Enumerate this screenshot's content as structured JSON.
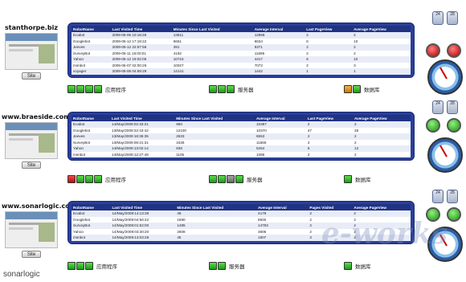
{
  "headers1": [
    "RobotName",
    "Last Visited Time",
    "Minutes Since Last Visited",
    "Average Interval",
    "Last PageView",
    "Average PageView"
  ],
  "headers2": [
    "RobotName",
    "Last Visited Time",
    "Minutes Since Last Visited",
    "Average Interval",
    "Last PageView",
    "Average PageView"
  ],
  "headers3": [
    "RobotName",
    "Last Visited Time",
    "Minutes Since Last Visited",
    "Average Interval",
    "Pages Visited",
    "Average PageView"
  ],
  "site_button": "Site",
  "labels": {
    "app": "应用程序",
    "server": "服务器",
    "db": "数据库"
  },
  "mini": [
    "24",
    "28"
  ],
  "sections": [
    {
      "name": "stanthorpe.biz",
      "rows": [
        [
          "Ecabot",
          "2009-05-06 10:18:26",
          "13511",
          "12966",
          "2",
          "2"
        ],
        [
          "Googlebot",
          "2009-05-12 17:19:22",
          "5651",
          "6634",
          "6",
          "10"
        ],
        [
          "Jeeves",
          "2009-05-12 22:57:56",
          "391",
          "5371",
          "2",
          "2"
        ],
        [
          "SurveyBot",
          "2009-05-11 16:00:01",
          "4192",
          "11695",
          "2",
          "2"
        ],
        [
          "Yahoo",
          "2009-05-12 19:02:05",
          "10715",
          "4417",
          "6",
          "10"
        ],
        [
          "msnbot",
          "2009-05-07 02:00:26",
          "10027",
          "7072",
          "2",
          "3"
        ],
        [
          "voyager",
          "2009-05-06 04:59:29",
          "14141",
          "1442",
          "1",
          "1"
        ]
      ],
      "lights": [
        [
          "g",
          "g",
          "g",
          "g"
        ],
        [
          "g",
          "g",
          "g"
        ],
        [
          "o",
          "g"
        ]
      ]
    },
    {
      "name": "www.braeside.com.au",
      "rows": [
        [
          "Ecabot",
          "14/May/2009:02:33:21",
          "950",
          "10387",
          "2",
          "2"
        ],
        [
          "Googlebot",
          "13/May/2009:22:43:42",
          "12100",
          "10370",
          "47",
          "35"
        ],
        [
          "Jeeves",
          "13/May/2009:18:36:35",
          "2633",
          "6553",
          "2",
          "2"
        ],
        [
          "SurveyBot",
          "13/May/2009:08:21:31",
          "3426",
          "11566",
          "2",
          "2"
        ],
        [
          "Yahoo",
          "14/May/2009:13:02:14",
          "836",
          "5264",
          "5",
          "12"
        ],
        [
          "msnbot",
          "14/May/2009:12:27:48",
          "1105",
          "1086",
          "2",
          "2"
        ]
      ],
      "lights": [
        [
          "r",
          "g",
          "g",
          "g"
        ],
        [
          "g",
          "g",
          "gr",
          "g"
        ],
        [
          "g"
        ]
      ]
    },
    {
      "name": "www.sonarlogic.com",
      "rows": [
        [
          "Ecabot",
          "14/May/2009:14:13:38",
          "46",
          "4179",
          "2",
          "2"
        ],
        [
          "Googlebot",
          "14/May/2009:04:56:42",
          "1690",
          "8926",
          "2",
          "2"
        ],
        [
          "SurveyBot",
          "14/May/2009:01:52:00",
          "1495",
          "14783",
          "2",
          "2"
        ],
        [
          "Yahoo",
          "14/May/2009:03:30:20",
          "2608",
          "3606",
          "2",
          "2"
        ],
        [
          "msnbot",
          "14/May/2009:13:03:28",
          "45",
          "1507",
          "3",
          "2"
        ]
      ],
      "lights": [
        [
          "g",
          "g",
          "g"
        ],
        [
          "g",
          "g"
        ],
        [
          "g"
        ]
      ]
    }
  ],
  "logo": {
    "a": "sonar",
    "b": "logic"
  },
  "watermark": "e-works"
}
